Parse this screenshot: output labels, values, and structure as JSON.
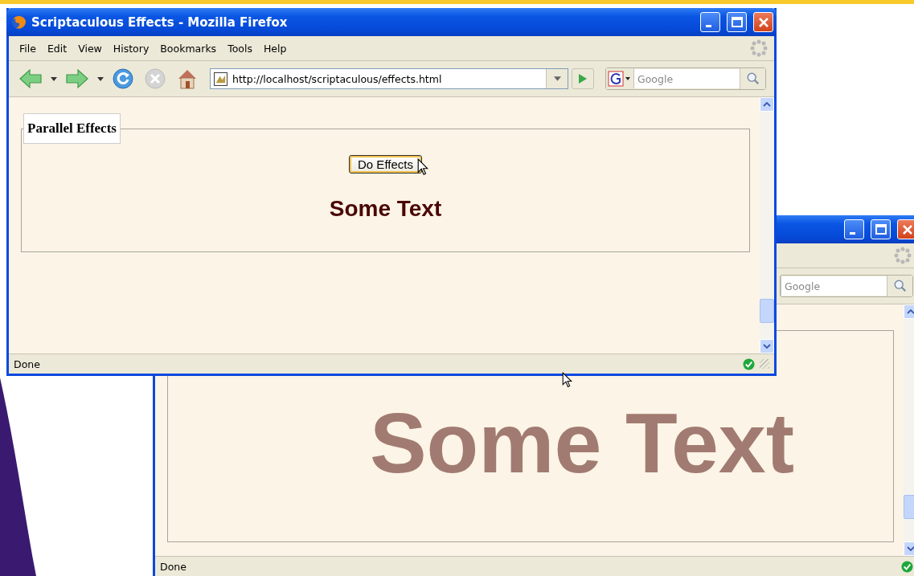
{
  "back_window": {
    "search": {
      "placeholder": "Google"
    },
    "heading": "Some Text",
    "status": "Done"
  },
  "front_window": {
    "title": "Scriptaculous Effects - Mozilla Firefox",
    "menu": [
      "File",
      "Edit",
      "View",
      "History",
      "Bookmarks",
      "Tools",
      "Help"
    ],
    "address": "http://localhost/scriptaculous/effects.html",
    "search": {
      "placeholder": "Google"
    },
    "fieldset_legend": "Parallel Effects",
    "button": "Do Effects",
    "heading": "Some Text",
    "status": "Done"
  }
}
